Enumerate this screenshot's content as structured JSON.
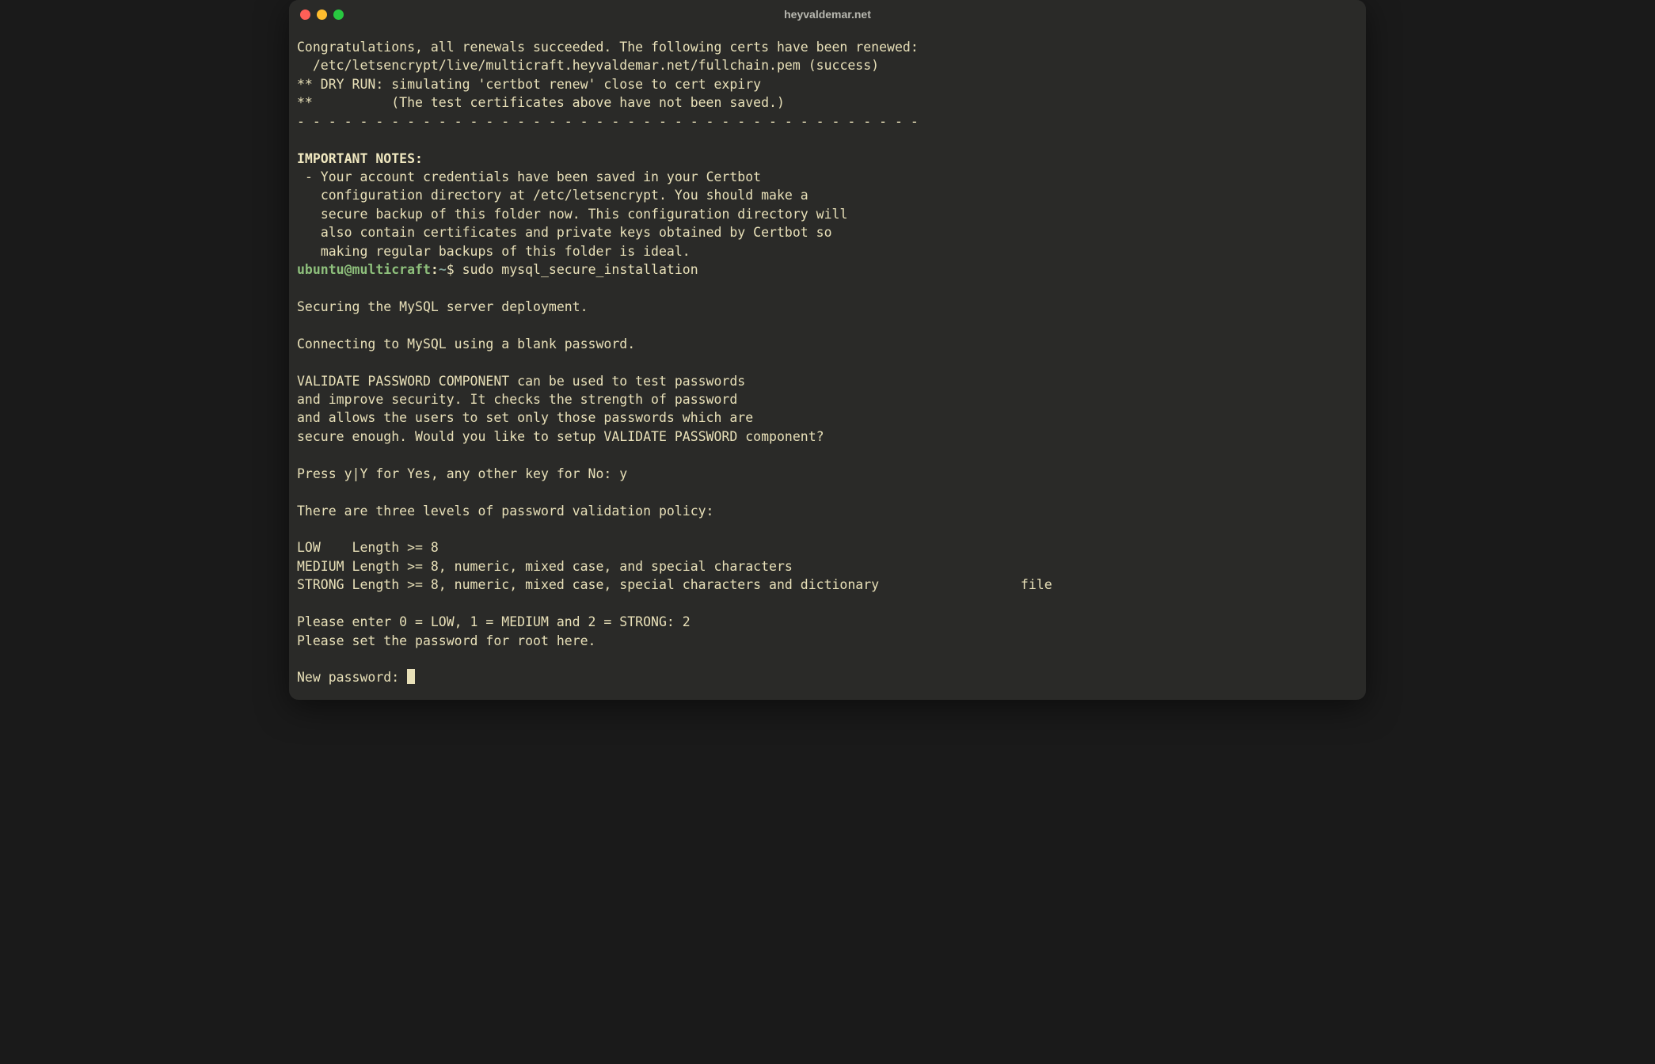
{
  "window": {
    "title": "heyvaldemar.net"
  },
  "terminal": {
    "line_congrats": "Congratulations, all renewals succeeded. The following certs have been renewed:",
    "line_cert": "  /etc/letsencrypt/live/multicraft.heyvaldemar.net/fullchain.pem (success)",
    "line_dry1": "** DRY RUN: simulating 'certbot renew' close to cert expiry",
    "line_dry2": "**          (The test certificates above have not been saved.)",
    "dashes": "- - - - - - - - - - - - - - - - - - - - - - - - - - - - - - - - - - - - - - - -",
    "important_header": "IMPORTANT NOTES:",
    "note1": " - Your account credentials have been saved in your Certbot",
    "note2": "   configuration directory at /etc/letsencrypt. You should make a",
    "note3": "   secure backup of this folder now. This configuration directory will",
    "note4": "   also contain certificates and private keys obtained by Certbot so",
    "note5": "   making regular backups of this folder is ideal.",
    "prompt_user": "ubuntu@multicraft",
    "prompt_sep": ":",
    "prompt_path": "~",
    "prompt_dollar": "$ ",
    "command": "sudo mysql_secure_installation",
    "secure1": "Securing the MySQL server deployment.",
    "secure2": "Connecting to MySQL using a blank password.",
    "vp1": "VALIDATE PASSWORD COMPONENT can be used to test passwords",
    "vp2": "and improve security. It checks the strength of password",
    "vp3": "and allows the users to set only those passwords which are",
    "vp4": "secure enough. Would you like to setup VALIDATE PASSWORD component?",
    "press": "Press y|Y for Yes, any other key for No: y",
    "levels_intro": "There are three levels of password validation policy:",
    "low": "LOW    Length >= 8",
    "medium": "MEDIUM Length >= 8, numeric, mixed case, and special characters",
    "strong": "STRONG Length >= 8, numeric, mixed case, special characters and dictionary                  file",
    "enter": "Please enter 0 = LOW, 1 = MEDIUM and 2 = STRONG: 2",
    "setpw": "Please set the password for root here.",
    "newpw": "New password: "
  }
}
